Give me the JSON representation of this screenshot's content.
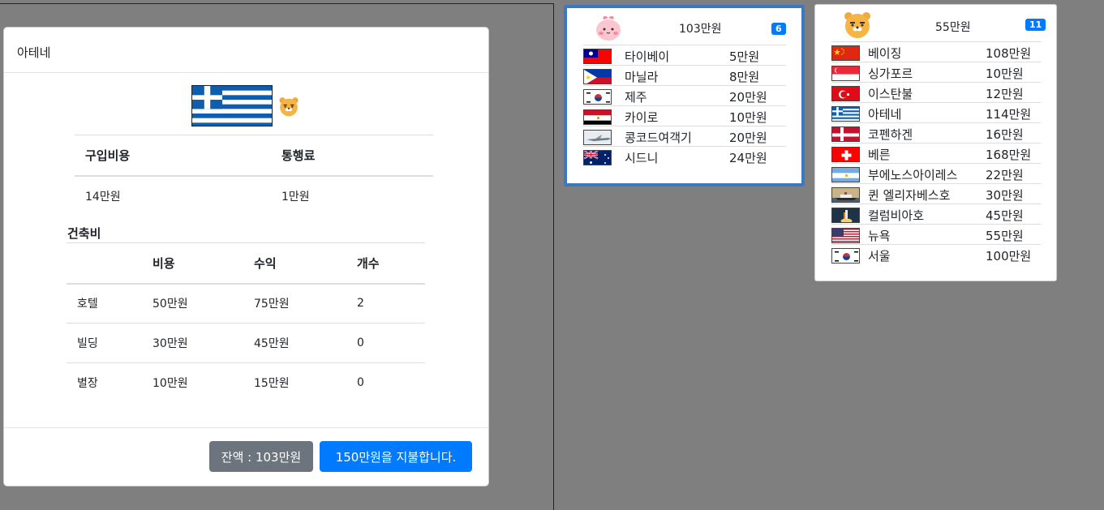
{
  "modal": {
    "title": "아테네",
    "purchase_header": "구입비용",
    "toll_header": "통행료",
    "purchase_value": "14만원",
    "toll_value": "1만원",
    "building_title": "건축비",
    "building_columns": [
      "",
      "비용",
      "수익",
      "개수"
    ],
    "buildings": [
      {
        "name": "호텔",
        "cost": "50만원",
        "income": "75만원",
        "count": "2"
      },
      {
        "name": "빌딩",
        "cost": "30만원",
        "income": "45만원",
        "count": "0"
      },
      {
        "name": "별장",
        "cost": "10만원",
        "income": "15만원",
        "count": "0"
      }
    ],
    "balance_label": "잔액 : 103만원",
    "pay_label": "150만원을 지불합니다."
  },
  "players": [
    {
      "money": "103만원",
      "badge": "6",
      "properties": [
        {
          "city": "타이베이",
          "price": "5만원",
          "flag": "taiwan-flag-icon"
        },
        {
          "city": "마닐라",
          "price": "8만원",
          "flag": "philippines-flag-icon"
        },
        {
          "city": "제주",
          "price": "20만원",
          "flag": "korea-flag-icon"
        },
        {
          "city": "카이로",
          "price": "10만원",
          "flag": "egypt-flag-icon"
        },
        {
          "city": "콩코드여객기",
          "price": "20만원",
          "flag": "concorde-icon"
        },
        {
          "city": "시드니",
          "price": "24만원",
          "flag": "australia-flag-icon"
        }
      ]
    },
    {
      "money": "55만원",
      "badge": "11",
      "properties": [
        {
          "city": "베이징",
          "price": "108만원",
          "flag": "china-flag-icon"
        },
        {
          "city": "싱가포르",
          "price": "10만원",
          "flag": "singapore-flag-icon"
        },
        {
          "city": "이스탄불",
          "price": "12만원",
          "flag": "turkey-flag-icon"
        },
        {
          "city": "아테네",
          "price": "114만원",
          "flag": "greece-flag-icon"
        },
        {
          "city": "코펜하겐",
          "price": "16만원",
          "flag": "denmark-flag-icon"
        },
        {
          "city": "베른",
          "price": "168만원",
          "flag": "switzerland-flag-icon"
        },
        {
          "city": "부에노스아이레스",
          "price": "22만원",
          "flag": "argentina-flag-icon"
        },
        {
          "city": "퀸 엘리자베스호",
          "price": "30만원",
          "flag": "queen-elizabeth-ship-icon"
        },
        {
          "city": "컬럼비아호",
          "price": "45만원",
          "flag": "columbia-shuttle-icon"
        },
        {
          "city": "뉴욕",
          "price": "55만원",
          "flag": "usa-flag-icon"
        },
        {
          "city": "서울",
          "price": "100만원",
          "flag": "korea-flag-icon"
        }
      ]
    }
  ],
  "colors": {
    "primary": "#007bff",
    "secondary": "#6c757d",
    "active_border": "#3a78c3",
    "backdrop": "#7f7f7f"
  }
}
